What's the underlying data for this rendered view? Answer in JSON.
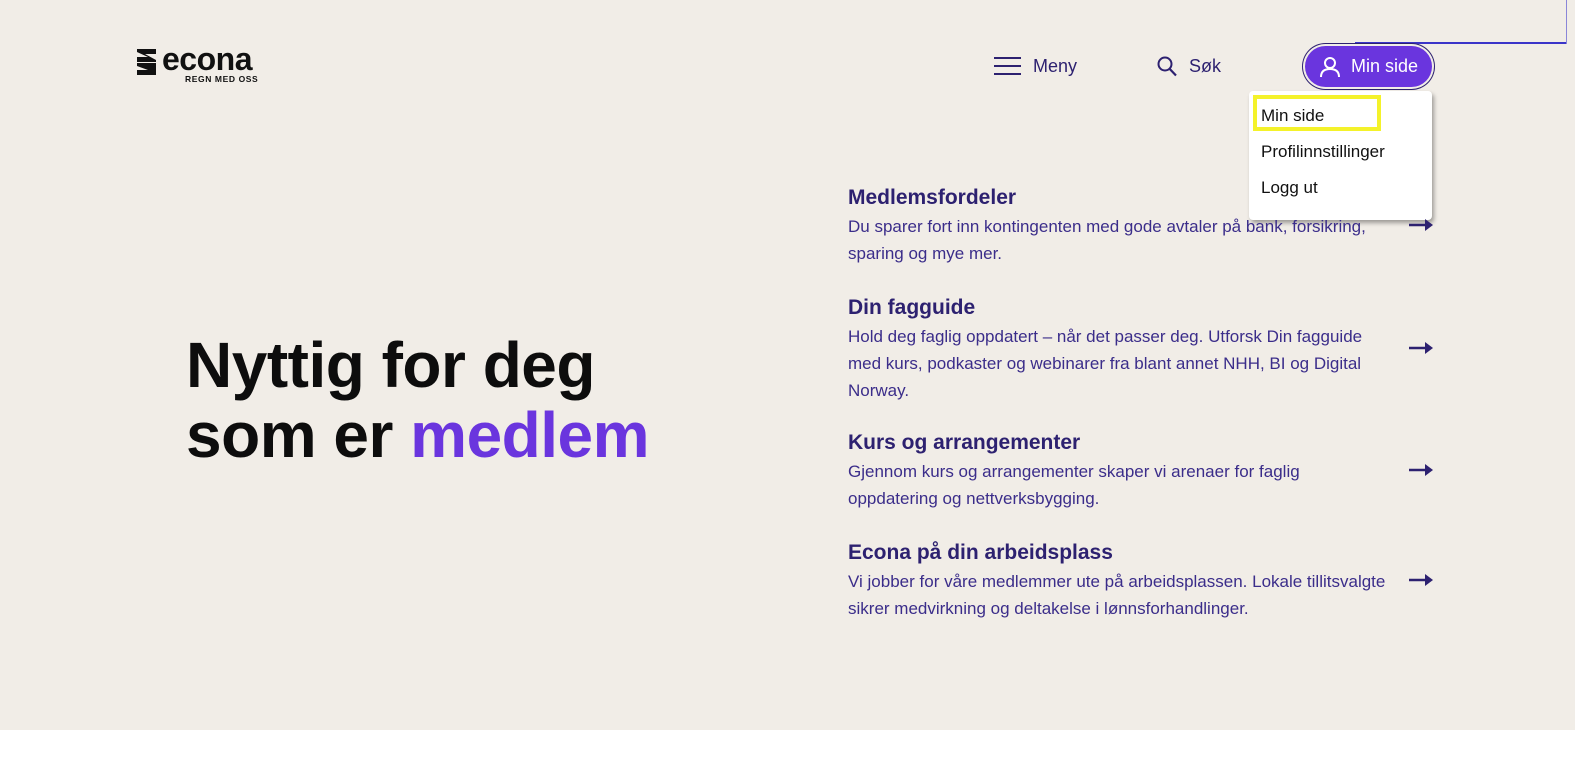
{
  "brand": {
    "name": "econa",
    "tagline": "REGN MED OSS"
  },
  "header": {
    "menu_label": "Meny",
    "search_label": "Søk",
    "account_label": "Min side"
  },
  "dropdown": {
    "items": [
      {
        "label": "Min side"
      },
      {
        "label": "Profilinnstillinger"
      },
      {
        "label": "Logg ut"
      }
    ],
    "highlighted_index": 0
  },
  "hero": {
    "line1": "Nyttig for deg",
    "line2_prefix": "som er",
    "line2_accent": "medlem"
  },
  "features": [
    {
      "title": "Medlemsfordeler",
      "desc": "Du sparer fort inn kontingenten med gode avtaler på bank, forsikring, sparing og mye mer."
    },
    {
      "title": "Din fagguide",
      "desc": "Hold deg faglig oppdatert – når det passer deg. Utforsk Din fagguide med kurs, podkaster og webinarer fra blant annet NHH, BI og Digital Norway."
    },
    {
      "title": "Kurs og arrangementer",
      "desc": "Gjennom kurs og arrangementer skaper vi arenaer for faglig oppdatering og nettverksbygging."
    },
    {
      "title": "Econa på din arbeidsplass",
      "desc": "Vi jobber for våre medlemmer ute på arbeidsplassen. Lokale tillitsvalgte sikrer medvirkning og deltakelse i lønnsforhandlinger."
    }
  ],
  "icons": {
    "menu": "hamburger-icon",
    "search": "search-icon",
    "account": "user-icon",
    "arrow": "arrow-right-icon"
  },
  "colors": {
    "background": "#f1ede7",
    "primary": "#6a35de",
    "text_dark": "#2d2170",
    "highlight": "#f4f22a"
  }
}
